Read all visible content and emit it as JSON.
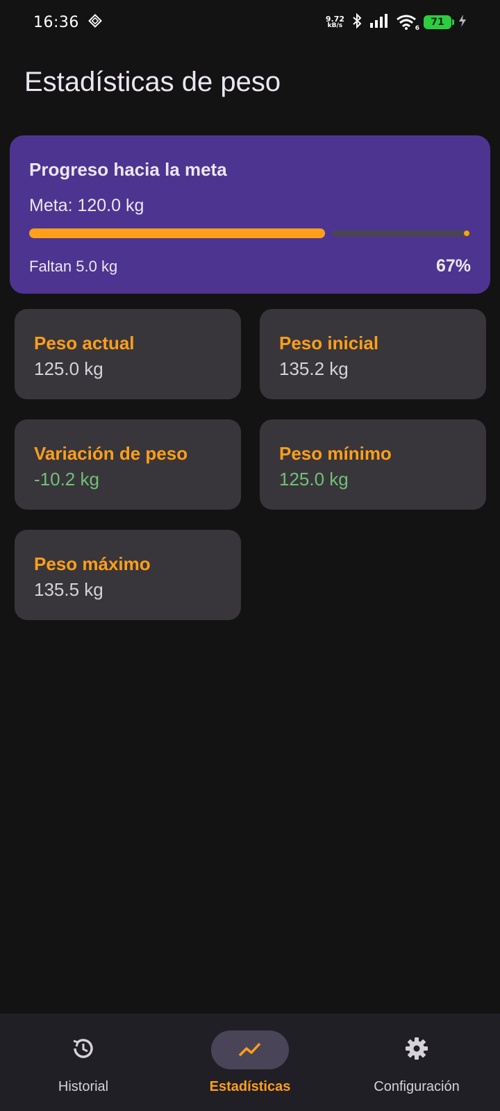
{
  "status_bar": {
    "time": "16:36",
    "net_speed_value": "9.72",
    "net_speed_unit": "kB/s",
    "wifi_badge": "6",
    "battery_level": "71"
  },
  "header": {
    "title": "Estadísticas de peso"
  },
  "progress": {
    "title": "Progreso hacia la meta",
    "goal": "Meta: 120.0 kg",
    "remaining": "Faltan 5.0 kg",
    "percent_label": "67%",
    "percent_value": 67
  },
  "stats": [
    {
      "label": "Peso actual",
      "value": "125.0 kg"
    },
    {
      "label": "Peso inicial",
      "value": "135.2 kg"
    },
    {
      "label": "Variación de peso",
      "value": "-10.2 kg"
    },
    {
      "label": "Peso mínimo",
      "value": "125.0 kg"
    },
    {
      "label": "Peso máximo",
      "value": "135.5 kg"
    }
  ],
  "nav": {
    "items": [
      {
        "label": "Historial",
        "icon": "history-icon"
      },
      {
        "label": "Estadísticas",
        "icon": "trending-up-icon"
      },
      {
        "label": "Configuración",
        "icon": "gear-icon"
      }
    ],
    "active_index": 1
  },
  "colors": {
    "accent": "#ff9f1a",
    "card_purple": "#4e3491",
    "card_gray": "#38363b",
    "positive": "#71c176",
    "background": "#131314"
  }
}
